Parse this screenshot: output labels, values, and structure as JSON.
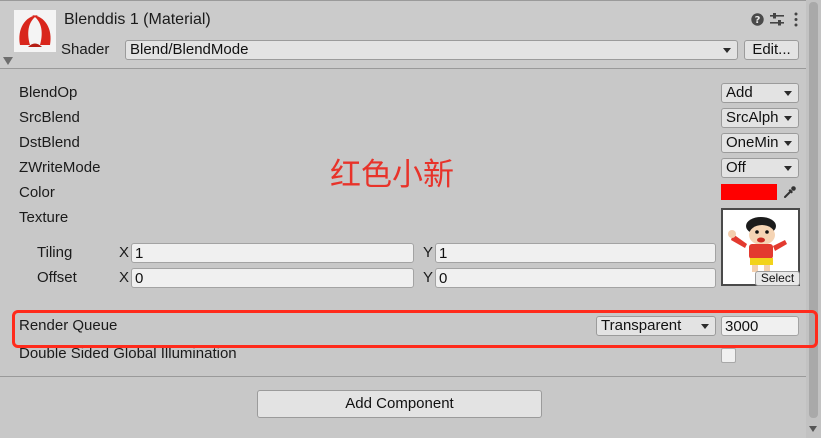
{
  "header": {
    "title": "Blenddis 1 (Material)",
    "shader_label": "Shader",
    "shader_value": "Blend/BlendMode",
    "edit_label": "Edit...",
    "icons": {
      "material": "material-icon",
      "help": "help-icon",
      "settings": "settings-icon",
      "more": "more-icon",
      "foldout": "foldout-arrow-icon"
    }
  },
  "properties": [
    {
      "label": "BlendOp",
      "value": "Add"
    },
    {
      "label": "SrcBlend",
      "value": "SrcAlph"
    },
    {
      "label": "DstBlend",
      "value": "OneMin"
    },
    {
      "label": "ZWriteMode",
      "value": "Off"
    }
  ],
  "color_property": {
    "label": "Color",
    "value": "#ff0000",
    "picker_icon": "eyedropper-icon"
  },
  "texture": {
    "label": "Texture",
    "select_label": "Select",
    "tiling": {
      "label": "Tiling",
      "x_label": "X",
      "x": "1",
      "y_label": "Y",
      "y": "1"
    },
    "offset": {
      "label": "Offset",
      "x_label": "X",
      "x": "0",
      "y_label": "Y",
      "y": "0"
    }
  },
  "annotation": {
    "text": "红色小新",
    "color": "#e8332a"
  },
  "render_queue": {
    "label": "Render Queue",
    "mode": "Transparent",
    "value": "3000",
    "highlight_color": "#ff2b1c"
  },
  "double_sided_gi": {
    "label": "Double Sided Global Illumination",
    "checked": false
  },
  "add_component_label": "Add Component",
  "theme": {
    "panel_background": "#c8c8c8",
    "header_background": "#cbcbcb"
  }
}
